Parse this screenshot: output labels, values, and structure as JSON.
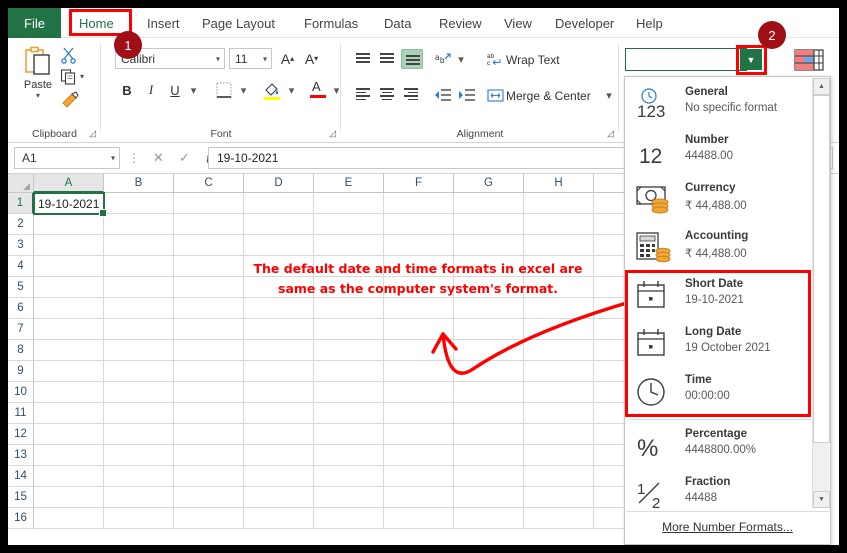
{
  "ribbon": {
    "file_tab": "File",
    "tabs": [
      {
        "label": "Home",
        "active": true
      },
      {
        "label": "Insert",
        "active": false
      },
      {
        "label": "Page Layout",
        "active": false
      },
      {
        "label": "Formulas",
        "active": false
      },
      {
        "label": "Data",
        "active": false
      },
      {
        "label": "Review",
        "active": false
      },
      {
        "label": "View",
        "active": false
      },
      {
        "label": "Developer",
        "active": false
      },
      {
        "label": "Help",
        "active": false
      }
    ],
    "groups": {
      "clipboard": "Clipboard",
      "font": "Font",
      "alignment": "Alignment"
    },
    "clipboard": {
      "paste_label": "Paste",
      "cut_icon": "scissors-icon",
      "copy_icon": "copy-icon",
      "format_painter_icon": "format-painter-icon"
    },
    "font": {
      "family_value": "Calibri",
      "size_value": "11",
      "grow_font": "A",
      "shrink_font": "A",
      "bold": "B",
      "italic": "I",
      "underline": "U"
    },
    "alignment": {
      "wrap_text": "Wrap Text",
      "merge_center": "Merge & Center"
    },
    "number": {
      "format_value": "",
      "dropdown_icon": "chevron-down-icon"
    }
  },
  "formula_bar": {
    "name_box": "A1",
    "cancel_icon": "close-icon",
    "enter_icon": "check-icon",
    "function_icon": "fx-icon",
    "value": "19-10-2021"
  },
  "grid": {
    "columns": [
      "A",
      "B",
      "C",
      "D",
      "E",
      "F",
      "G",
      "H"
    ],
    "rows": [
      "1",
      "2",
      "3",
      "4",
      "5",
      "6",
      "7",
      "8",
      "9",
      "10",
      "11",
      "12",
      "13",
      "14",
      "15",
      "16"
    ],
    "selected_cell": "A1",
    "selected_value": "19-10-2021"
  },
  "annotation": {
    "line1": "The default date and time formats in excel are",
    "line2": "same as the computer system's format.",
    "arrow": "curved-arrow-icon",
    "color": "#ff0000"
  },
  "callouts": [
    {
      "number": "1",
      "target": "home-tab"
    },
    {
      "number": "2",
      "target": "number-format-dropdown"
    }
  ],
  "dropdown": {
    "items": [
      {
        "title": "General",
        "sample": "No specific format",
        "icon": "general-123-icon",
        "highlighted": false
      },
      {
        "title": "Number",
        "sample": "44488.00",
        "icon": "number-12-icon",
        "highlighted": false
      },
      {
        "title": "Currency",
        "sample": "₹ 44,488.00",
        "icon": "currency-icon",
        "highlighted": false
      },
      {
        "title": "Accounting",
        "sample": "₹ 44,488.00",
        "icon": "accounting-icon",
        "highlighted": false
      },
      {
        "title": "Short Date",
        "sample": "19-10-2021",
        "icon": "calendar-icon",
        "highlighted": true
      },
      {
        "title": "Long Date",
        "sample": "19 October 2021",
        "icon": "calendar-icon",
        "highlighted": true
      },
      {
        "title": "Time",
        "sample": "00:00:00",
        "icon": "clock-icon",
        "highlighted": true
      },
      {
        "title": "Percentage",
        "sample": "4448800.00%",
        "icon": "percent-icon",
        "highlighted": false
      },
      {
        "title": "Fraction",
        "sample": "44488",
        "icon": "fraction-icon",
        "highlighted": false
      }
    ],
    "more_formats": "More Number Formats...",
    "scroll_up_icon": "triangle-up-icon",
    "scroll_down_icon": "triangle-down-icon"
  },
  "colors": {
    "excel_green": "#217346",
    "highlight_red": "#ff0000",
    "badge_red": "#a10f16"
  }
}
